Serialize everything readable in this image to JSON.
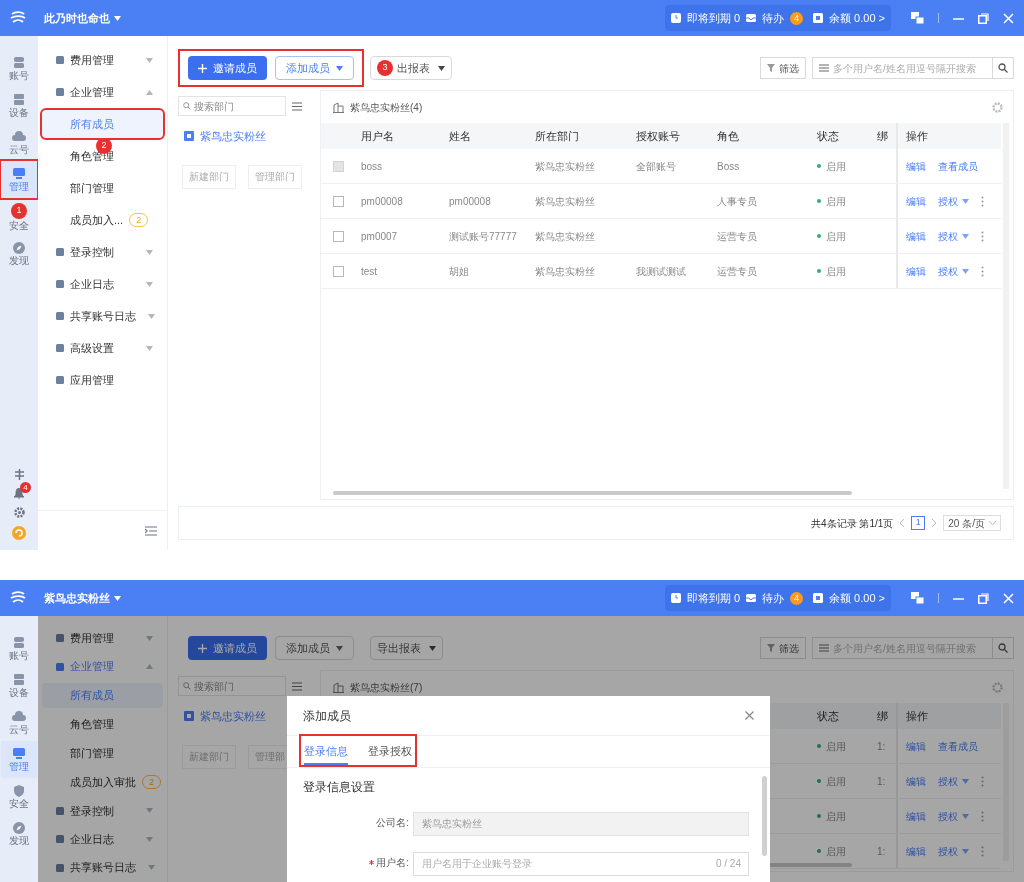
{
  "screens": [
    {
      "header": {
        "company": "此乃时也命也",
        "expiring": "即将到期 0",
        "todo": "待办",
        "todo_count": "4",
        "balance": "余额 0.00 >"
      },
      "rail": [
        {
          "label": "账号",
          "selected": false,
          "annotated": false
        },
        {
          "label": "设备",
          "selected": false,
          "annotated": false
        },
        {
          "label": "云号",
          "selected": false,
          "annotated": false
        },
        {
          "label": "管理",
          "selected": true,
          "annotated": true
        },
        {
          "label": "安全",
          "selected": false,
          "annotated": false,
          "callout": "1"
        },
        {
          "label": "发现",
          "selected": false,
          "annotated": false
        }
      ],
      "rail_footer": {
        "notification_count": "4"
      },
      "nav": [
        {
          "label": "费用管理",
          "expanded": false,
          "active": false
        },
        {
          "label": "企业管理",
          "expanded": true,
          "active": false,
          "children": [
            {
              "label": "所有成员",
              "selected": true,
              "annotated": true
            },
            {
              "label": "角色管理",
              "selected": false,
              "annotated": false,
              "callout": "2"
            },
            {
              "label": "部门管理",
              "selected": false,
              "annotated": false
            },
            {
              "label": "成员加入...",
              "selected": false,
              "annotated": false,
              "count": "2"
            }
          ]
        },
        {
          "label": "登录控制",
          "expanded": false,
          "active": false
        },
        {
          "label": "企业日志",
          "expanded": false,
          "active": false
        },
        {
          "label": "共享账号日志",
          "expanded": false,
          "active": false
        },
        {
          "label": "高级设置",
          "expanded": false,
          "active": false
        },
        {
          "label": "应用管理",
          "active": false
        }
      ],
      "nav_collapse": true,
      "toolbar": {
        "annotated": true,
        "invite": "邀请成员",
        "add": {
          "label": "添加成员",
          "highlighted": true
        },
        "export": {
          "label": "出报表",
          "callout": "3"
        },
        "filter": "筛选",
        "search_placeholder": "多个用户名/姓名用逗号隔开搜索"
      },
      "dept_panel": {
        "search_placeholder": "搜索部门",
        "tree": [
          {
            "label": "紫鸟忠实粉丝",
            "selected": true
          }
        ],
        "buttons": [
          "新建部门",
          "管理部门"
        ]
      },
      "table": {
        "title": "紫鸟忠实粉丝(4)",
        "columns": {
          "username": "用户名",
          "name": "姓名",
          "department": "所在部门",
          "authorized_account": "授权账号",
          "role": "角色",
          "status": "状态",
          "column_8": "绑",
          "actions": "操作"
        },
        "rows": [
          {
            "disabled": true,
            "cells": {
              "username": "boss",
              "department": "紫鸟忠实粉丝",
              "authorized_account": "全部账号",
              "role": "Boss",
              "status": "启用"
            },
            "actions": [
              {
                "label": "编辑",
                "dropdown": false
              },
              {
                "label": "查看成员",
                "dropdown": false
              }
            ],
            "more": false
          },
          {
            "disabled": false,
            "cells": {
              "username": "pm00008",
              "name": "pm00008",
              "department": "紫鸟忠实粉丝",
              "role": "人事专员",
              "status": "启用"
            },
            "actions": [
              {
                "label": "编辑",
                "dropdown": false
              },
              {
                "label": "授权",
                "dropdown": true
              }
            ],
            "more": true
          },
          {
            "disabled": false,
            "cells": {
              "username": "pm0007",
              "name": "测试账号77777",
              "department": "紫鸟忠实粉丝",
              "role": "运营专员",
              "status": "启用"
            },
            "actions": [
              {
                "label": "编辑",
                "dropdown": false
              },
              {
                "label": "授权",
                "dropdown": true
              }
            ],
            "more": true
          },
          {
            "disabled": false,
            "cells": {
              "username": "test",
              "name": "胡姐",
              "department": "紫鸟忠实粉丝",
              "authorized_account": "我测试测试",
              "role": "运营专员",
              "status": "启用"
            },
            "actions": [
              {
                "label": "编辑",
                "dropdown": false
              },
              {
                "label": "授权",
                "dropdown": true
              }
            ],
            "more": true
          }
        ]
      },
      "pagination": {
        "summary": "共4条记录 第1/1页",
        "pages": [
          {
            "label": "1",
            "selected": true
          }
        ],
        "page_size": "20 条/页"
      }
    },
    {
      "header": {
        "company": "紫鸟忠实粉丝",
        "expiring": "即将到期 0",
        "todo": "待办",
        "todo_count": "4",
        "balance": "余额 0.00 >"
      },
      "rail": [
        {
          "label": "账号",
          "selected": false,
          "annotated": false
        },
        {
          "label": "设备",
          "selected": false,
          "annotated": false
        },
        {
          "label": "云号",
          "selected": false,
          "annotated": false
        },
        {
          "label": "管理",
          "selected": true,
          "annotated": false
        },
        {
          "label": "安全",
          "selected": false,
          "annotated": false
        },
        {
          "label": "发现",
          "selected": false,
          "annotated": false
        }
      ],
      "nav": [
        {
          "label": "费用管理",
          "expanded": false,
          "active": false
        },
        {
          "label": "企业管理",
          "expanded": true,
          "active": true,
          "children": [
            {
              "label": "所有成员",
              "selected": true,
              "annotated": false
            },
            {
              "label": "角色管理",
              "selected": false,
              "annotated": false
            },
            {
              "label": "部门管理",
              "selected": false,
              "annotated": false
            },
            {
              "label": "成员加入审批",
              "selected": false,
              "annotated": false,
              "count": "2"
            }
          ]
        },
        {
          "label": "登录控制",
          "expanded": false,
          "active": false
        },
        {
          "label": "企业日志",
          "expanded": false,
          "active": false
        },
        {
          "label": "共享账号日志",
          "expanded": false,
          "active": false
        }
      ],
      "toolbar": {
        "annotated": false,
        "invite": "邀请成员",
        "add": {
          "label": "添加成员",
          "highlighted": false
        },
        "export": {
          "label": "导出报表"
        },
        "filter": "筛选",
        "search_placeholder": "多个用户名/姓名用逗号隔开搜索"
      },
      "dept_panel": {
        "search_placeholder": "搜索部门",
        "tree": [
          {
            "label": "紫鸟忠实粉丝",
            "selected": true
          }
        ],
        "buttons": [
          "新建部门",
          "管理部"
        ]
      },
      "table": {
        "title": "紫鸟忠实粉丝(7)",
        "columns": {
          "status": "状态",
          "column_8": "绑",
          "actions": "操作"
        },
        "rows": [
          {
            "cells": {
              "status": "启用",
              "column_8": "1:"
            },
            "actions": [
              {
                "label": "编辑",
                "dropdown": false
              },
              {
                "label": "查看成员",
                "dropdown": false
              }
            ],
            "more": false
          },
          {
            "cells": {
              "status": "启用",
              "column_8": "1:"
            },
            "actions": [
              {
                "label": "编辑",
                "dropdown": false
              },
              {
                "label": "授权",
                "dropdown": true
              }
            ],
            "more": true
          },
          {
            "cells": {
              "status": "启用"
            },
            "actions": [
              {
                "label": "编辑",
                "dropdown": false
              },
              {
                "label": "授权",
                "dropdown": true
              }
            ],
            "more": true
          },
          {
            "cells": {
              "status": "启用",
              "column_8": "1:"
            },
            "actions": [
              {
                "label": "编辑",
                "dropdown": false
              },
              {
                "label": "授权",
                "dropdown": true
              }
            ],
            "more": true
          }
        ]
      },
      "dialog": {
        "title": "添加成员",
        "tabs_annotated": true,
        "tabs": [
          {
            "label": "登录信息",
            "selected": true
          },
          {
            "label": "登录授权",
            "selected": false
          }
        ],
        "section": "登录信息设置",
        "fields": [
          {
            "label": "公司名:",
            "value": "紫鸟忠实粉丝",
            "disabled": true
          },
          {
            "label": "用户名:",
            "placeholder": "用户名用于企业账号登录",
            "counter": "0 / 24",
            "disabled": false,
            "required": true
          }
        ]
      }
    }
  ]
}
